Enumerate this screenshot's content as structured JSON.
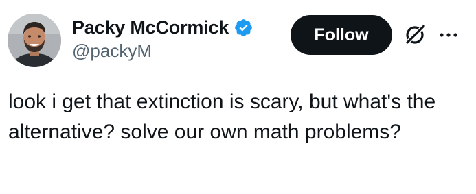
{
  "author": {
    "display_name": "Packy McCormick",
    "handle": "@packyM",
    "verified": true,
    "verified_color": "#1d9bf0",
    "avatar_icon": "user-avatar-photo"
  },
  "actions": {
    "follow_label": "Follow",
    "grok_icon": "grok-icon",
    "more_icon": "more-options-icon"
  },
  "tweet": {
    "text": "look i get that extinction is scary, but what's the alternative? solve our own math problems?"
  },
  "colors": {
    "text": "#0f1419",
    "secondary": "#536471",
    "follow_bg": "#0f1419",
    "follow_text": "#ffffff",
    "background": "#ffffff"
  }
}
